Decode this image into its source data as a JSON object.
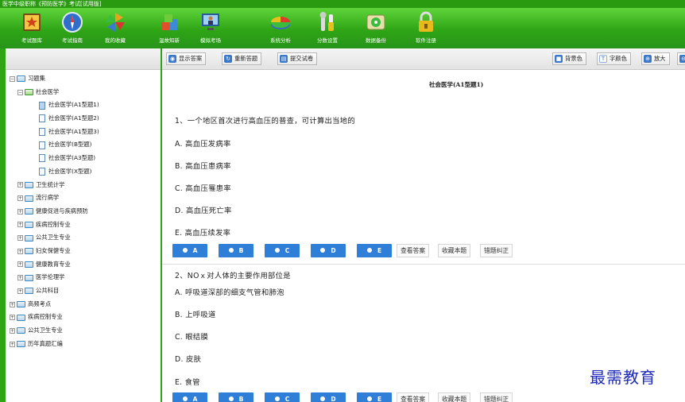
{
  "window": {
    "title": "医学中级职称《预防医学》考试[试用版]"
  },
  "toolbar": {
    "items": [
      {
        "label": "考试题库"
      },
      {
        "label": "考试指南"
      },
      {
        "label": "我的收藏"
      },
      {
        "label": "温故知新"
      },
      {
        "label": "模拟考场"
      },
      {
        "label": "系统分析"
      },
      {
        "label": "分数设置"
      },
      {
        "label": "数据备份"
      },
      {
        "label": "软件注册"
      }
    ]
  },
  "tree": {
    "nodes": [
      {
        "label": "习题集"
      },
      {
        "label": "社会医学"
      },
      {
        "label": "社会医学(A1型题1)"
      },
      {
        "label": "社会医学(A1型题2)"
      },
      {
        "label": "社会医学(A1型题3)"
      },
      {
        "label": "社会医学(B型题)"
      },
      {
        "label": "社会医学(A3型题)"
      },
      {
        "label": "社会医学(X型题)"
      },
      {
        "label": "卫生统计学"
      },
      {
        "label": "流行病学"
      },
      {
        "label": "健康促进与疾病预防"
      },
      {
        "label": "疾病控制专业"
      },
      {
        "label": "公共卫生专业"
      },
      {
        "label": "妇女保健专业"
      },
      {
        "label": "健康教育专业"
      },
      {
        "label": "医学伦理学"
      },
      {
        "label": "公共科目"
      },
      {
        "label": "高频考点"
      },
      {
        "label": "疾病控制专业"
      },
      {
        "label": "公共卫生专业"
      },
      {
        "label": "历年真题汇编"
      }
    ]
  },
  "content_toolbar": {
    "show_answer": "显示答案",
    "reanswer": "重新答题",
    "submit": "提交试卷",
    "bg_color": "背景色",
    "font_color": "字颜色",
    "zoom_in": "放大"
  },
  "content": {
    "doc_title": "社会医学(A1型题1)",
    "questions": [
      {
        "stem": "1、一个地区首次进行高血压的普查，可计算出当地的",
        "options": [
          "A. 高血压发病率",
          "B. 高血压患病率",
          "C. 高血压罹患率",
          "D. 高血压死亡率",
          "E. 高血压续发率"
        ]
      },
      {
        "stem": "2、NOｘ对人体的主要作用部位是",
        "options": [
          "A. 呼吸道深部的细支气管和肺泡",
          "B. 上呼吸道",
          "C. 眼结膜",
          "D. 皮肤",
          "E. 食管"
        ]
      }
    ],
    "answer_letters": [
      "A",
      "B",
      "C",
      "D",
      "E"
    ],
    "actions": {
      "view": "查看答案",
      "fav": "收藏本题",
      "fix": "错题纠正"
    }
  },
  "watermark": "最需教育"
}
